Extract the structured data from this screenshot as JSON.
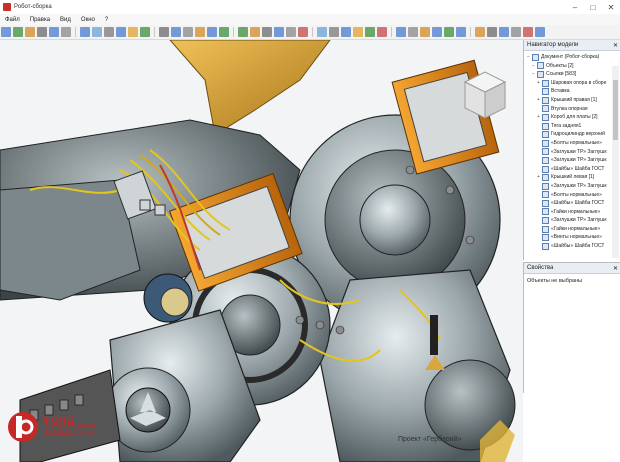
{
  "window": {
    "title": "Робот-сборка"
  },
  "menu": [
    "Файл",
    "Правка",
    "Вид",
    "Окно",
    "?"
  ],
  "navigator": {
    "title": "Навигатор модели",
    "items": [
      {
        "indent": 0,
        "exp": "−",
        "label": "Документ (Робот-сборка)"
      },
      {
        "indent": 1,
        "exp": "−",
        "label": "Объекты [2]"
      },
      {
        "indent": 1,
        "exp": "−",
        "label": "Ссылки [583]"
      },
      {
        "indent": 2,
        "exp": "+",
        "label": "Шаровая опора в сборе"
      },
      {
        "indent": 2,
        "exp": "",
        "label": "Вставка"
      },
      {
        "indent": 2,
        "exp": "+",
        "label": "Крышкий правая [1]"
      },
      {
        "indent": 2,
        "exp": "",
        "label": "Втулка опорная"
      },
      {
        "indent": 2,
        "exp": "+",
        "label": "Короб для платы [2]"
      },
      {
        "indent": 2,
        "exp": "",
        "label": "Тяга задняя1"
      },
      {
        "indent": 2,
        "exp": "",
        "label": "Гидроцилиндр верхний"
      },
      {
        "indent": 2,
        "exp": "",
        "label": "«Болты нормальные»"
      },
      {
        "indent": 2,
        "exp": "",
        "label": "«Заглушки ТР» Заглушк"
      },
      {
        "indent": 2,
        "exp": "",
        "label": "«Заглушки ТР» Заглушк"
      },
      {
        "indent": 2,
        "exp": "",
        "label": "«Шайбы» Шайба ГОСТ"
      },
      {
        "indent": 2,
        "exp": "+",
        "label": "Крышкий левая [1]"
      },
      {
        "indent": 2,
        "exp": "",
        "label": "«Заглушки ТР» Заглушк"
      },
      {
        "indent": 2,
        "exp": "",
        "label": "«Болты нормальные»"
      },
      {
        "indent": 2,
        "exp": "",
        "label": "«Шайбы» Шайба ГОСТ"
      },
      {
        "indent": 2,
        "exp": "",
        "label": "«Гайки нормальные»"
      },
      {
        "indent": 2,
        "exp": "",
        "label": "«Заглушки ТР» Заглушк"
      },
      {
        "indent": 2,
        "exp": "",
        "label": "«Гайки нормальные»"
      },
      {
        "indent": 2,
        "exp": "",
        "label": "«Винты нормальные»"
      },
      {
        "indent": 2,
        "exp": "",
        "label": "«Шайбы» Шайба ГОСТ"
      }
    ]
  },
  "properties": {
    "title": "Свойства",
    "status": "Объекты не выбраны"
  },
  "logo": {
    "line1": "ФОНД",
    "line2": "ПЕРСПЕКТИВНЫХ",
    "line3": "ИССЛЕДОВАНИЙ"
  },
  "caption": "Проект «Гербарий»",
  "colors": {
    "orange": "#e08a1a",
    "yellow_panel": "#d9a640",
    "metal": "#9aa4a8",
    "red": "#c62828"
  }
}
